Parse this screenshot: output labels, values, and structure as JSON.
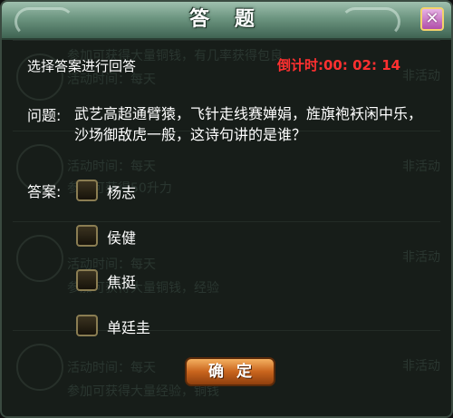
{
  "dialog": {
    "title": "答 题",
    "close_label": "✕"
  },
  "quiz": {
    "instruction": "选择答案进行回答",
    "timer": "倒计时:00: 02: 14",
    "question_label": "问题:",
    "question_text": "武艺高超通臂猿，飞针走线赛婵娟，旌旗袍袄闲中乐，沙场御敌虎一般，这诗句讲的是谁？",
    "answer_label": "答案:",
    "options": [
      "杨志",
      "侯健",
      "焦挺",
      "单廷圭"
    ],
    "confirm_label": "确定"
  },
  "background": {
    "rows": [
      {
        "line1": "参加可获得大量铜钱，有几率获得包良",
        "line2": "活动时间：每天",
        "status": "非活动"
      },
      {
        "line1": "活动时间：每天",
        "line2": "参加可获得50升力",
        "status": "非活动"
      },
      {
        "line1": "活动时间：每天",
        "line2": "参加可获得大量铜钱，经验",
        "status": "非活动"
      },
      {
        "line1": "活动时间：每天",
        "line2": "参加可获得大量经验，铜钱",
        "status": "非活动"
      }
    ]
  },
  "colors": {
    "timer": "#ff3030",
    "title_bar": "#6c9580",
    "confirm_button": "#c8641d",
    "close_button": "#b04ea9"
  }
}
